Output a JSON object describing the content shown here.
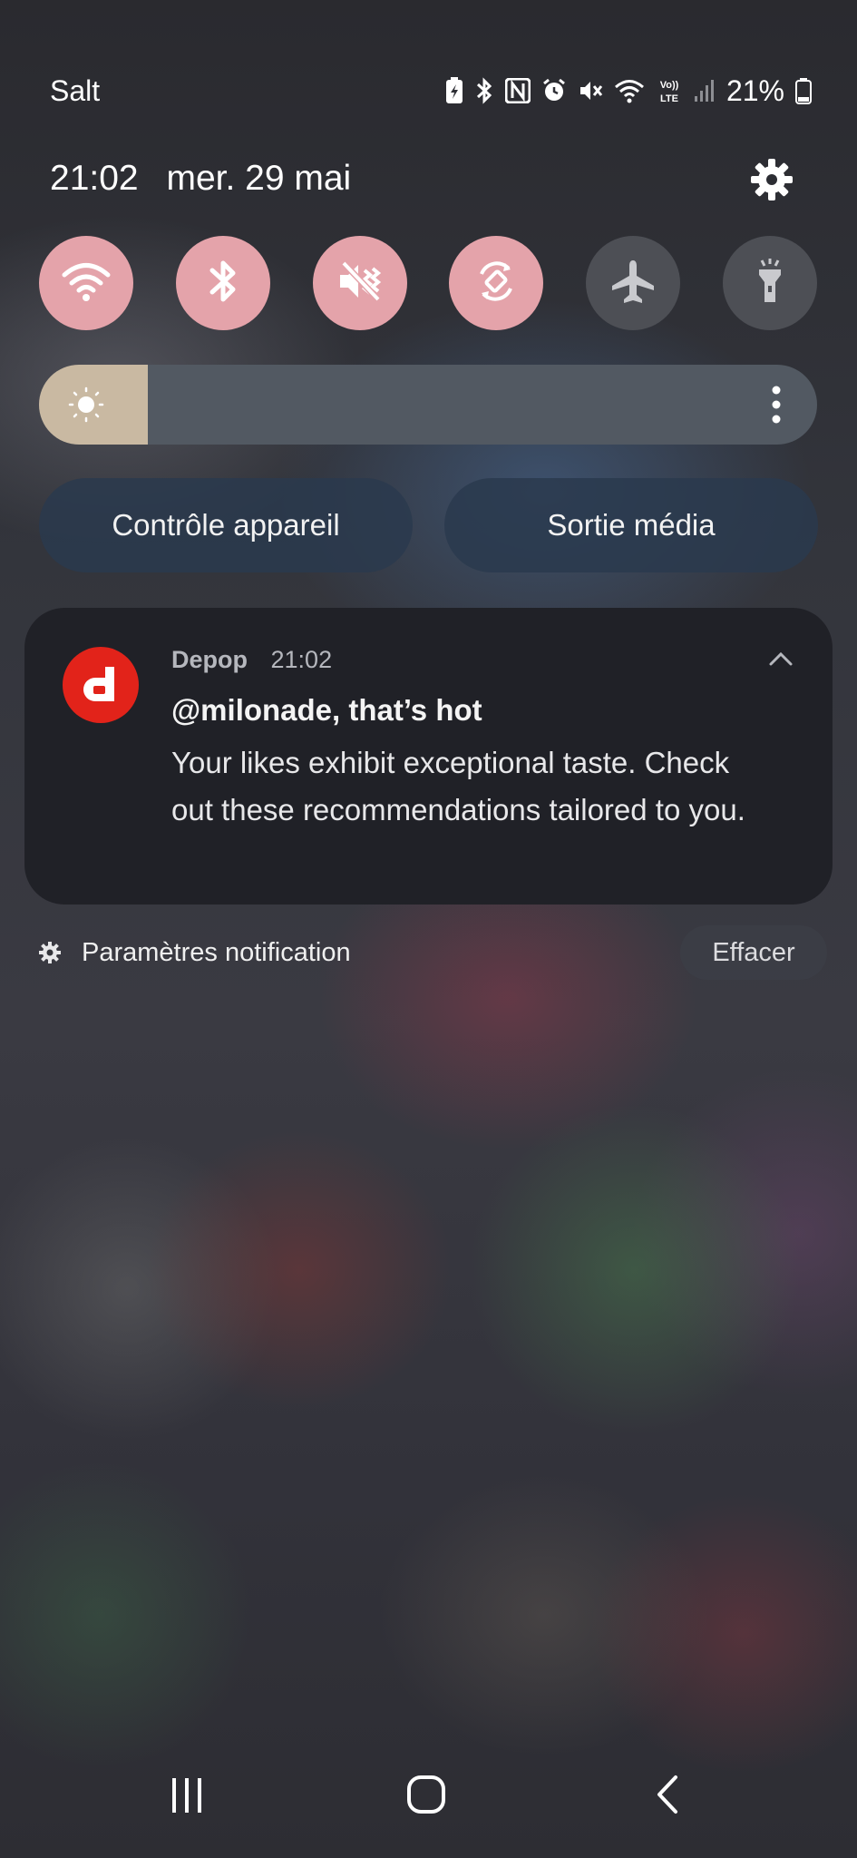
{
  "status_bar": {
    "carrier": "Salt",
    "battery_percent": "21%",
    "icons": [
      "battery-saver-icon",
      "bluetooth-icon",
      "nfc-icon",
      "alarm-icon",
      "mute-icon",
      "wifi-icon",
      "volte-lte-icon",
      "signal-icon",
      "battery-icon"
    ]
  },
  "header": {
    "time": "21:02",
    "date": "mer. 29 mai"
  },
  "quick_settings": {
    "toggles": [
      {
        "name": "wifi",
        "on": true
      },
      {
        "name": "bluetooth",
        "on": true
      },
      {
        "name": "mute",
        "on": true
      },
      {
        "name": "auto-rotate",
        "on": true
      },
      {
        "name": "airplane-mode",
        "on": false
      },
      {
        "name": "flashlight",
        "on": false
      }
    ],
    "brightness_level": 0.14,
    "device_control_label": "Contrôle appareil",
    "media_output_label": "Sortie média"
  },
  "notification": {
    "app_name": "Depop",
    "time": "21:02",
    "title": "@milonade, that’s hot",
    "body": "Your likes exhibit exceptional taste. Check out these recommendations tailored to you.",
    "app_icon_color": "#e2231a"
  },
  "notification_footer": {
    "settings_label": "Paramètres notification",
    "clear_label": "Effacer"
  },
  "colors": {
    "toggle_on": "#e4a3aa",
    "toggle_off": "#4d4f55",
    "brightness_fill": "#c9b9a2"
  }
}
